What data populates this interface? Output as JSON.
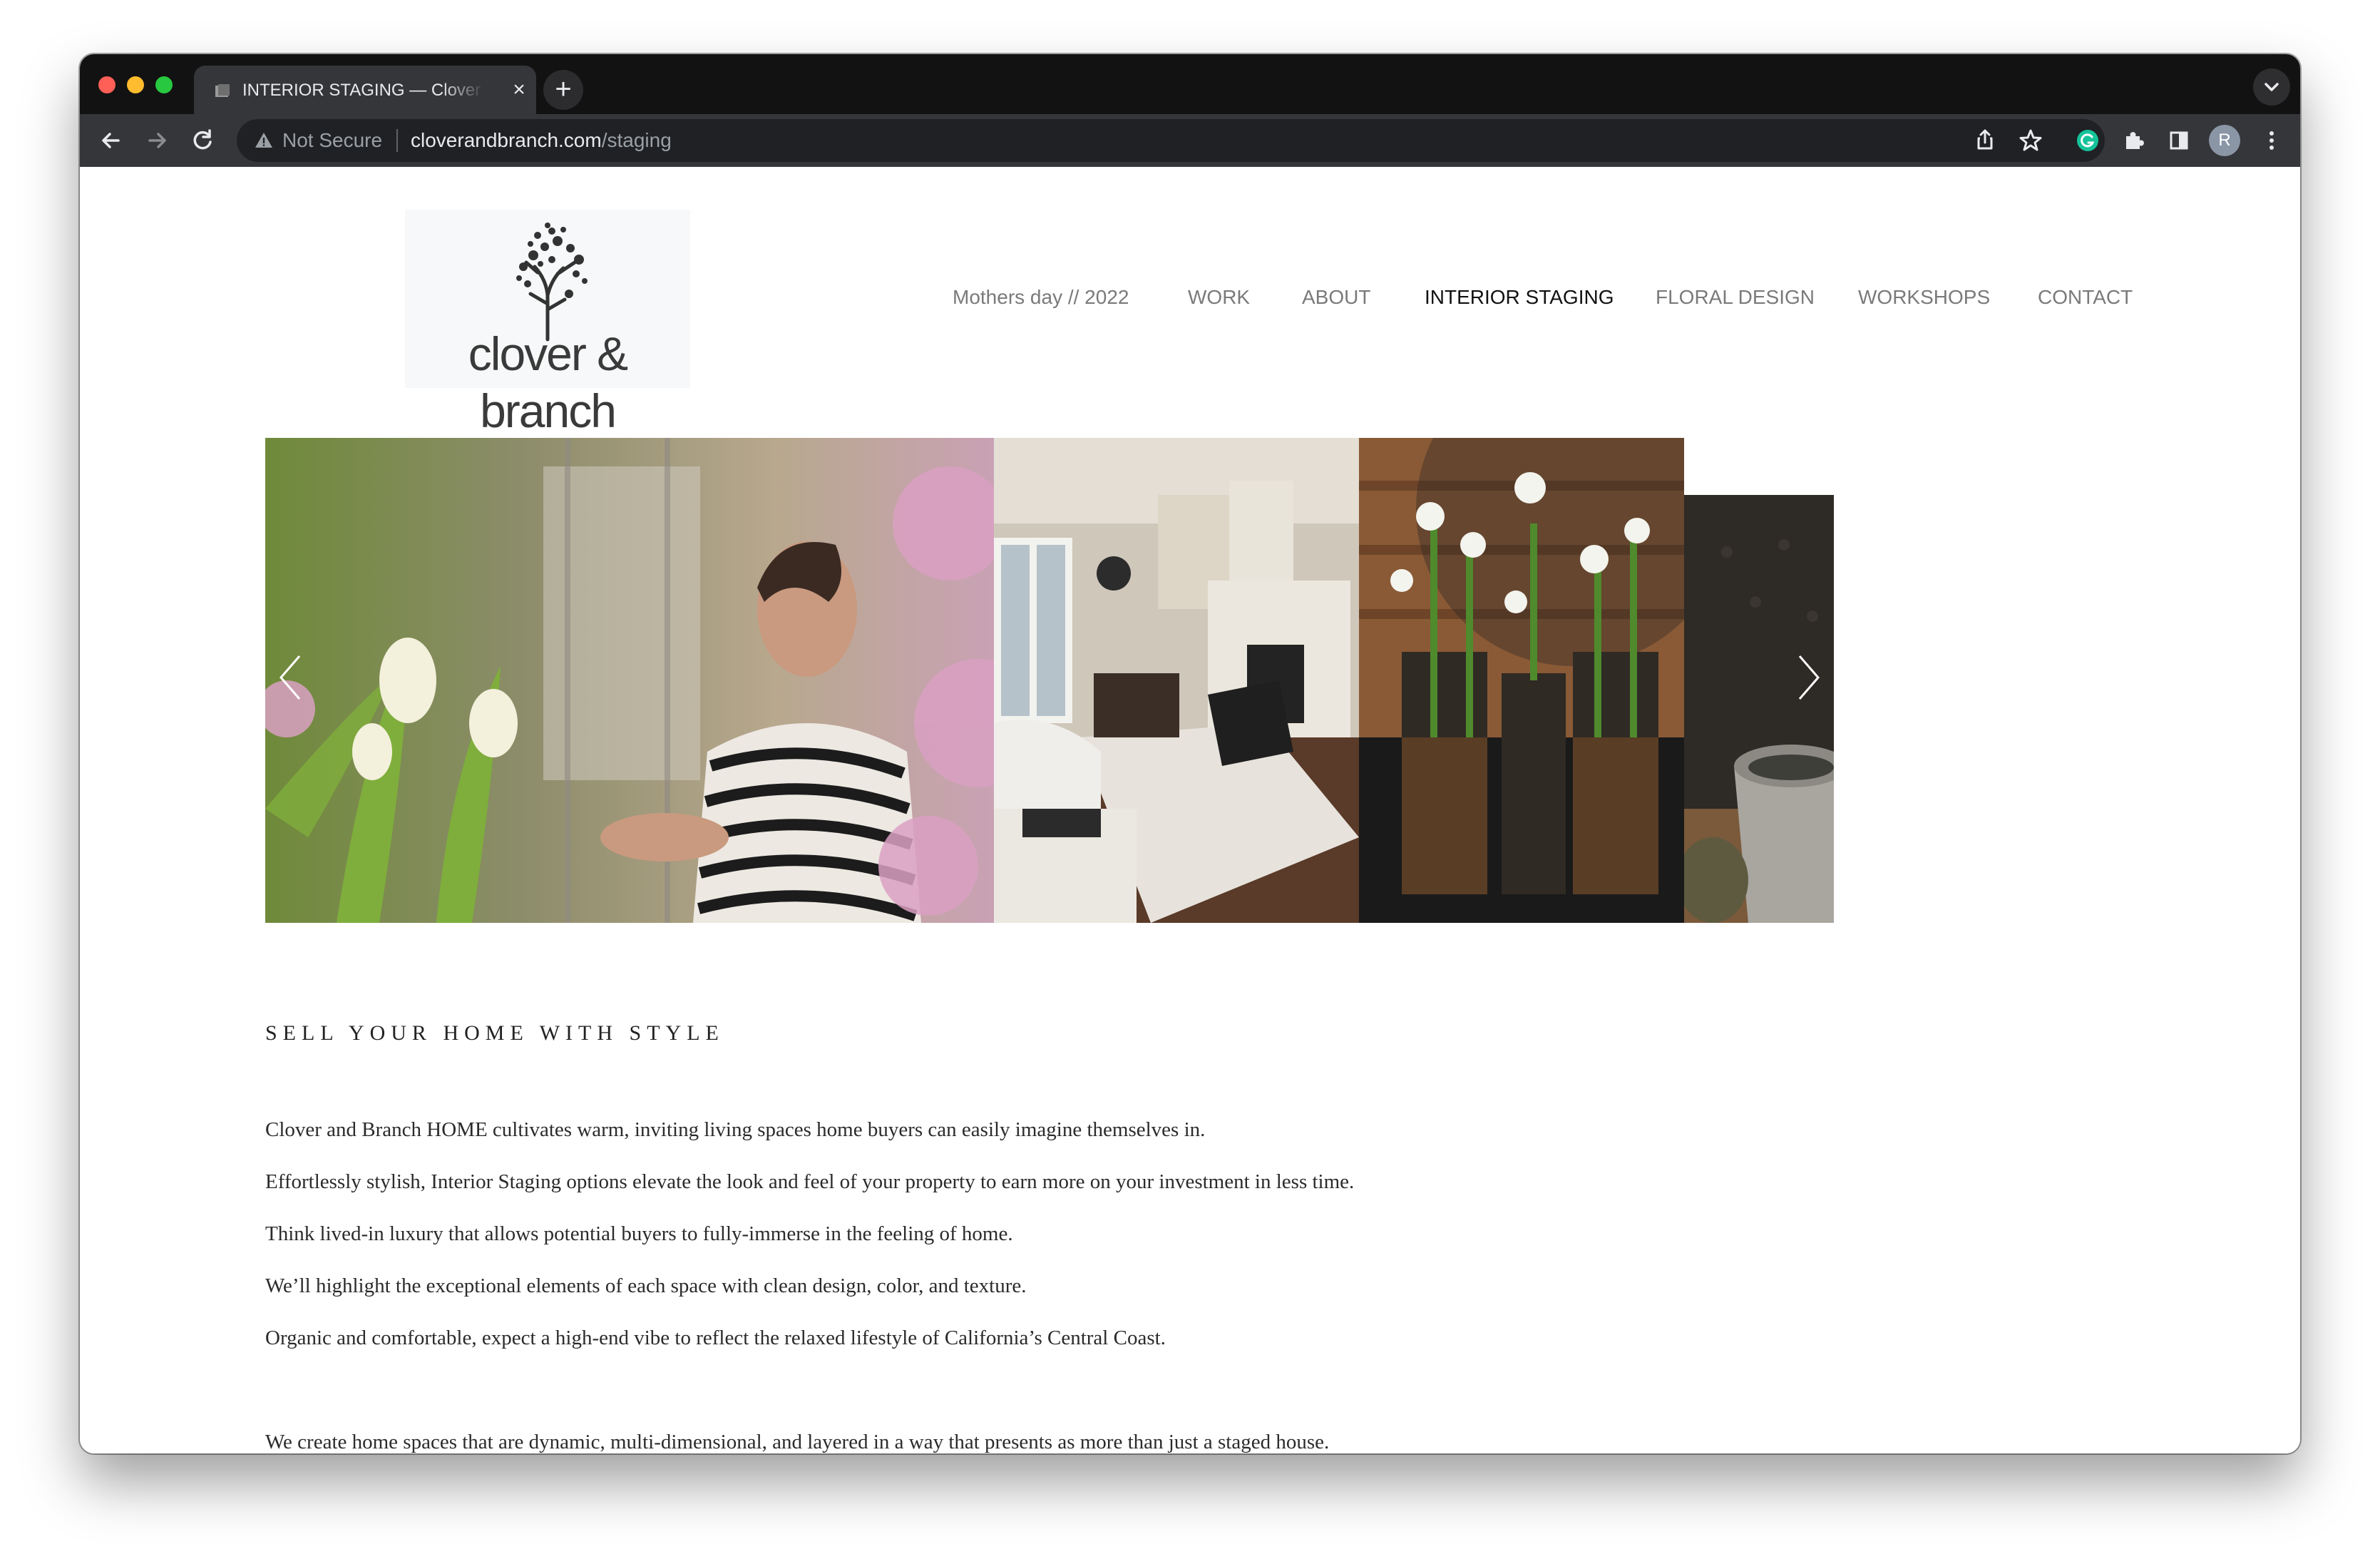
{
  "browser": {
    "tab_title": "INTERIOR STAGING — Clover & Branch",
    "new_tab_label": "+",
    "close_label": "×",
    "security_label": "Not Secure",
    "url_host": "cloverandbranch.com",
    "url_path": "/staging",
    "profile_initial": "R"
  },
  "site": {
    "logo_text": "clover & branch",
    "nav": [
      {
        "label": "Mothers day // 2022"
      },
      {
        "label": "WORK"
      },
      {
        "label": "ABOUT"
      },
      {
        "label": "INTERIOR STAGING",
        "active": true
      },
      {
        "label": "FLORAL DESIGN"
      },
      {
        "label": "WORKSHOPS"
      },
      {
        "label": "CONTACT"
      }
    ]
  },
  "content": {
    "heading": "SELL YOUR HOME WITH STYLE",
    "paragraphs": [
      "Clover and Branch HOME cultivates warm, inviting living spaces home buyers can easily imagine themselves in.",
      "Effortlessly stylish, Interior Staging options elevate the look and feel of your property to earn more on your investment in less time.",
      "Think lived-in luxury that allows potential buyers to fully-immerse in the feeling of home.",
      "We’ll highlight the exceptional elements of each space with clean design, color, and texture.",
      "Organic and comfortable, expect a high-end vibe to reflect the relaxed lifestyle of California’s Central Coast.",
      "We create home spaces that are dynamic, multi-dimensional, and layered in a way that presents as more than just a staged house."
    ]
  },
  "colors": {
    "tabstrip": "#121212",
    "toolbar": "#35363a",
    "omnibox": "#202124",
    "nav_active": "#111111",
    "nav_inactive": "#7a7a7a",
    "grammarly": "#15c39a"
  }
}
